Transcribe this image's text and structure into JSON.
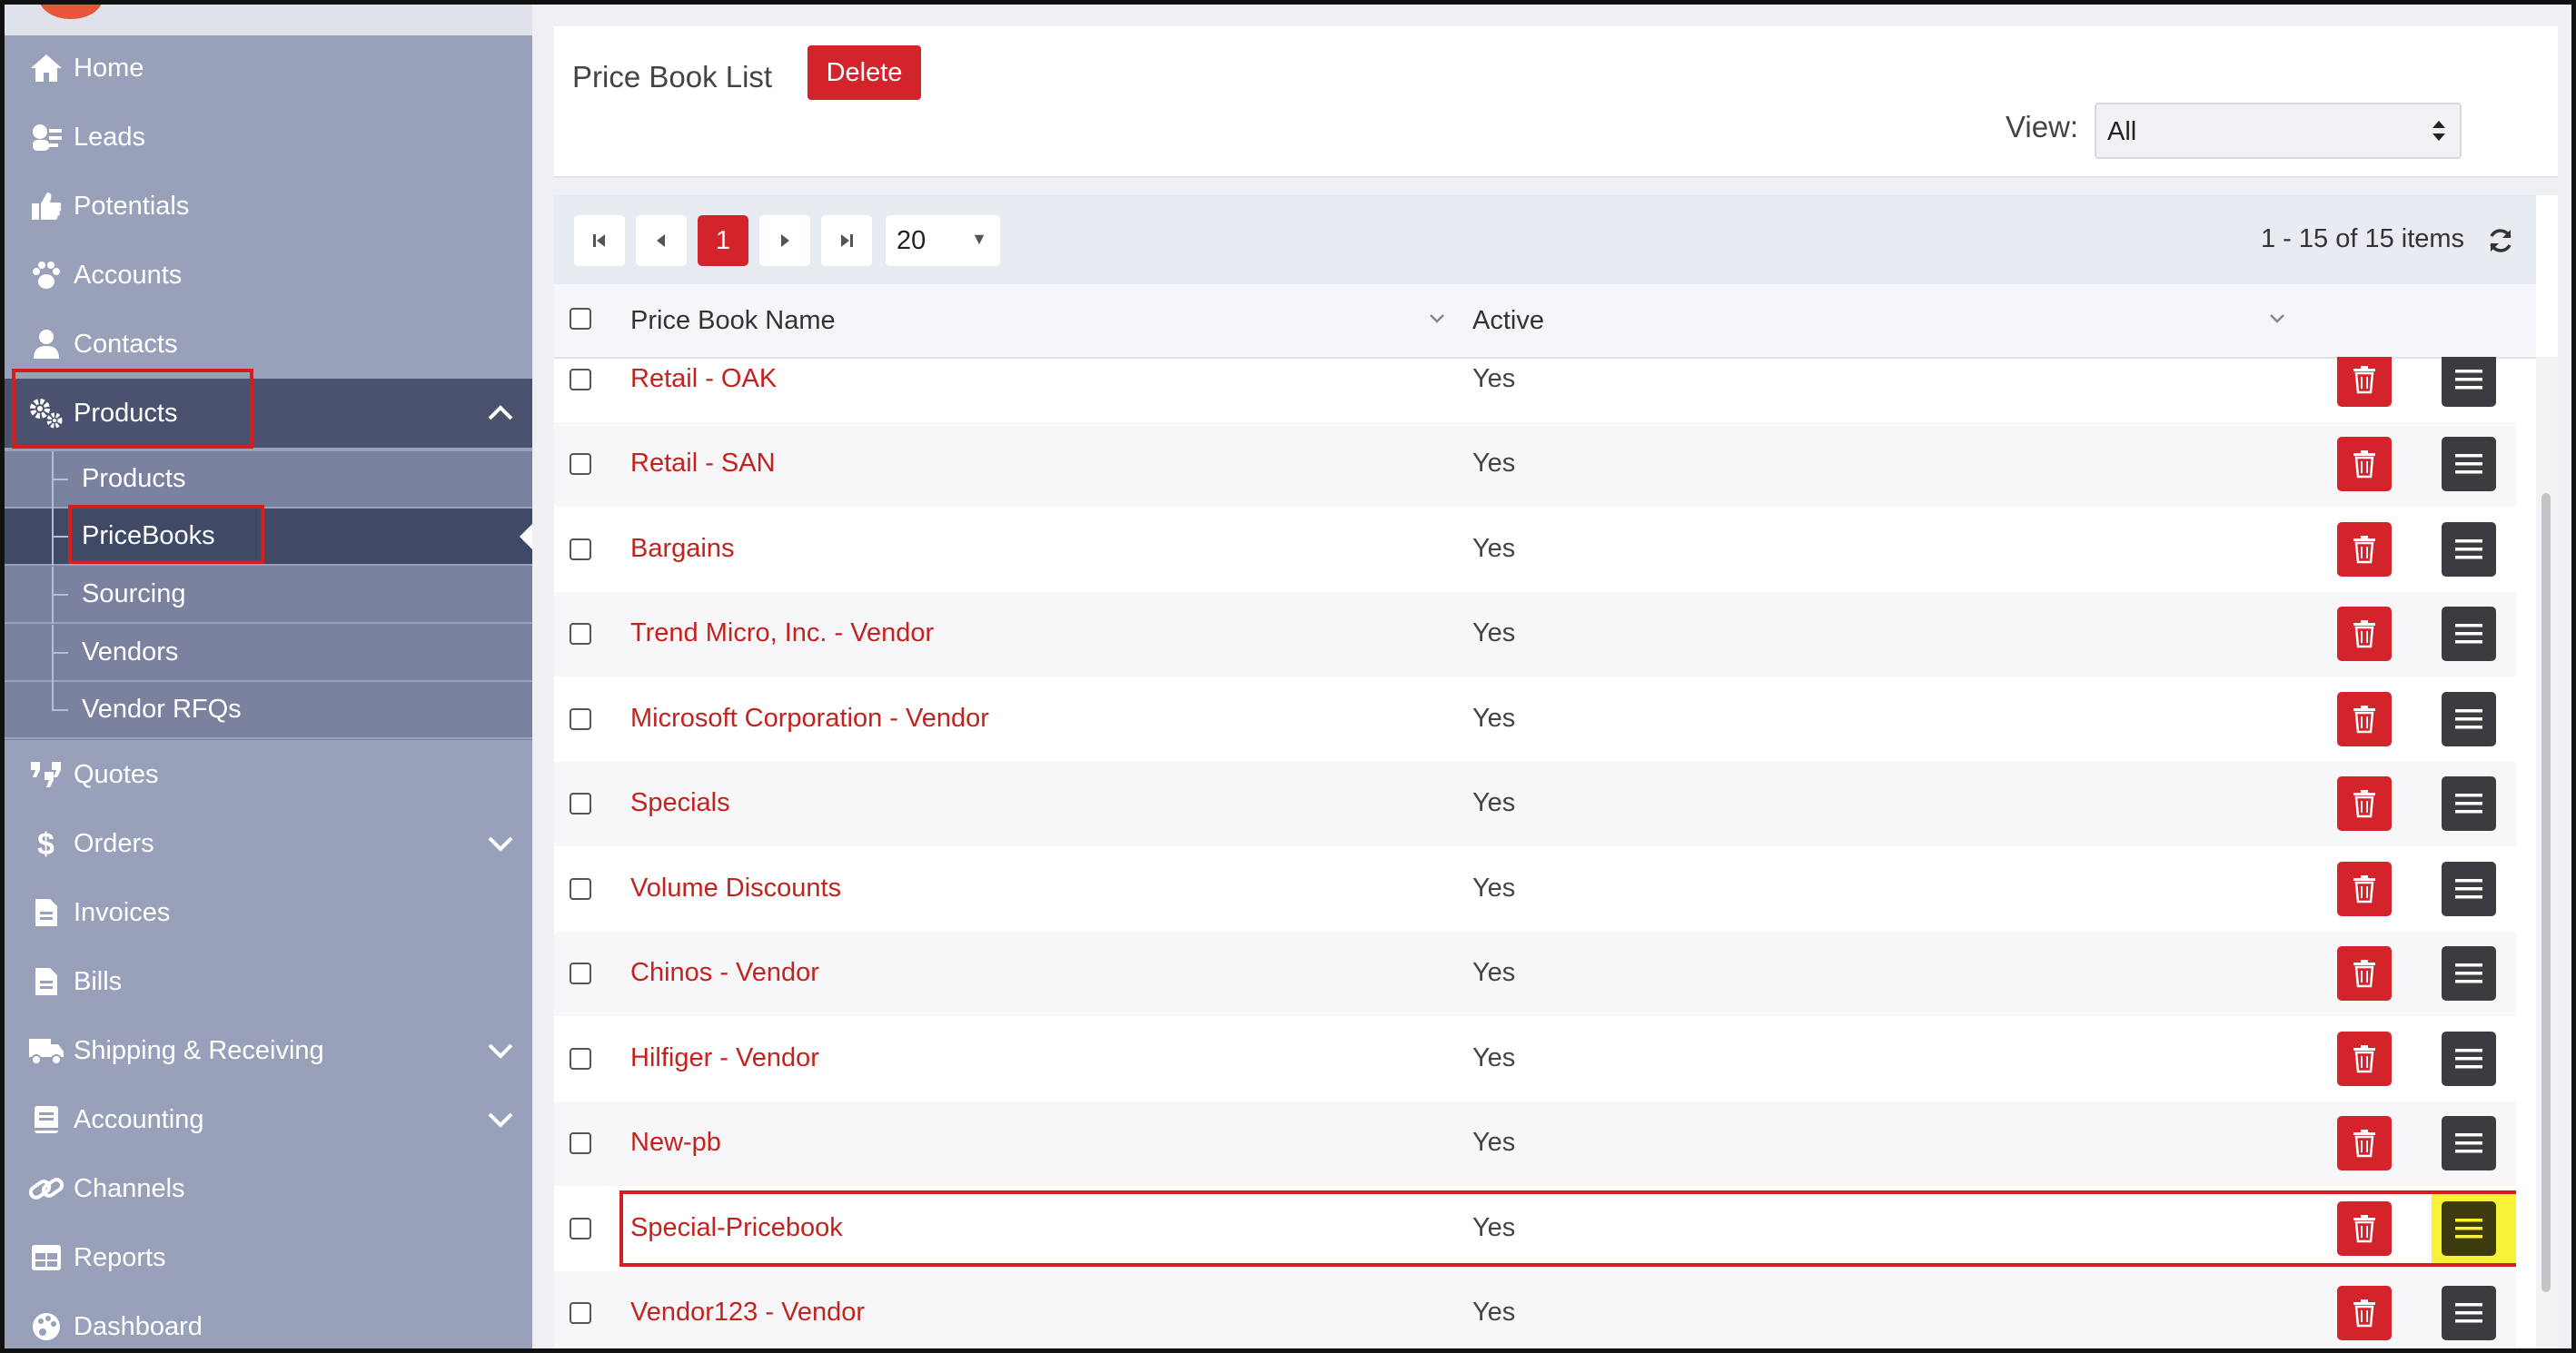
{
  "sidebar": {
    "items": [
      {
        "label": "Home",
        "icon": "home-icon"
      },
      {
        "label": "Leads",
        "icon": "leads-icon"
      },
      {
        "label": "Potentials",
        "icon": "thumbs-up-icon"
      },
      {
        "label": "Accounts",
        "icon": "paw-icon"
      },
      {
        "label": "Contacts",
        "icon": "user-icon"
      },
      {
        "label": "Products",
        "icon": "gears-icon",
        "expanded": true
      },
      {
        "label": "Quotes",
        "icon": "quote-icon"
      },
      {
        "label": "Orders",
        "icon": "dollar-icon",
        "has_children": true
      },
      {
        "label": "Invoices",
        "icon": "invoice-icon"
      },
      {
        "label": "Bills",
        "icon": "bill-icon"
      },
      {
        "label": "Shipping & Receiving",
        "icon": "truck-icon",
        "has_children": true
      },
      {
        "label": "Accounting",
        "icon": "book-icon",
        "has_children": true
      },
      {
        "label": "Channels",
        "icon": "link-icon"
      },
      {
        "label": "Reports",
        "icon": "table-icon"
      },
      {
        "label": "Dashboard",
        "icon": "palette-icon"
      }
    ],
    "submenu": [
      {
        "label": "Products"
      },
      {
        "label": "PriceBooks",
        "selected": true
      },
      {
        "label": "Sourcing"
      },
      {
        "label": "Vendors"
      },
      {
        "label": "Vendor RFQs"
      }
    ]
  },
  "header": {
    "title": "Price Book List",
    "delete_label": "Delete",
    "view_label": "View:",
    "view_value": "All"
  },
  "pager": {
    "current_page": "1",
    "page_size": "20",
    "info": "1 - 15 of 15 items"
  },
  "table": {
    "columns": [
      "Price Book Name",
      "Active"
    ],
    "rows": [
      {
        "name": "Retail - OAK",
        "active": "Yes"
      },
      {
        "name": "Retail - SAN",
        "active": "Yes"
      },
      {
        "name": "Bargains",
        "active": "Yes"
      },
      {
        "name": "Trend Micro, Inc. - Vendor",
        "active": "Yes"
      },
      {
        "name": "Microsoft Corporation - Vendor",
        "active": "Yes"
      },
      {
        "name": "Specials",
        "active": "Yes"
      },
      {
        "name": "Volume Discounts",
        "active": "Yes"
      },
      {
        "name": "Chinos - Vendor",
        "active": "Yes"
      },
      {
        "name": "Hilfiger - Vendor",
        "active": "Yes"
      },
      {
        "name": "New-pb",
        "active": "Yes"
      },
      {
        "name": "Special-Pricebook",
        "active": "Yes",
        "highlighted": true
      },
      {
        "name": "Vendor123 - Vendor",
        "active": "Yes"
      }
    ]
  },
  "colors": {
    "brand_red": "#d3232b",
    "sidebar_bg": "#98a0ba",
    "sidebar_active": "#4a5270",
    "highlight_yellow": "#f6f236"
  }
}
